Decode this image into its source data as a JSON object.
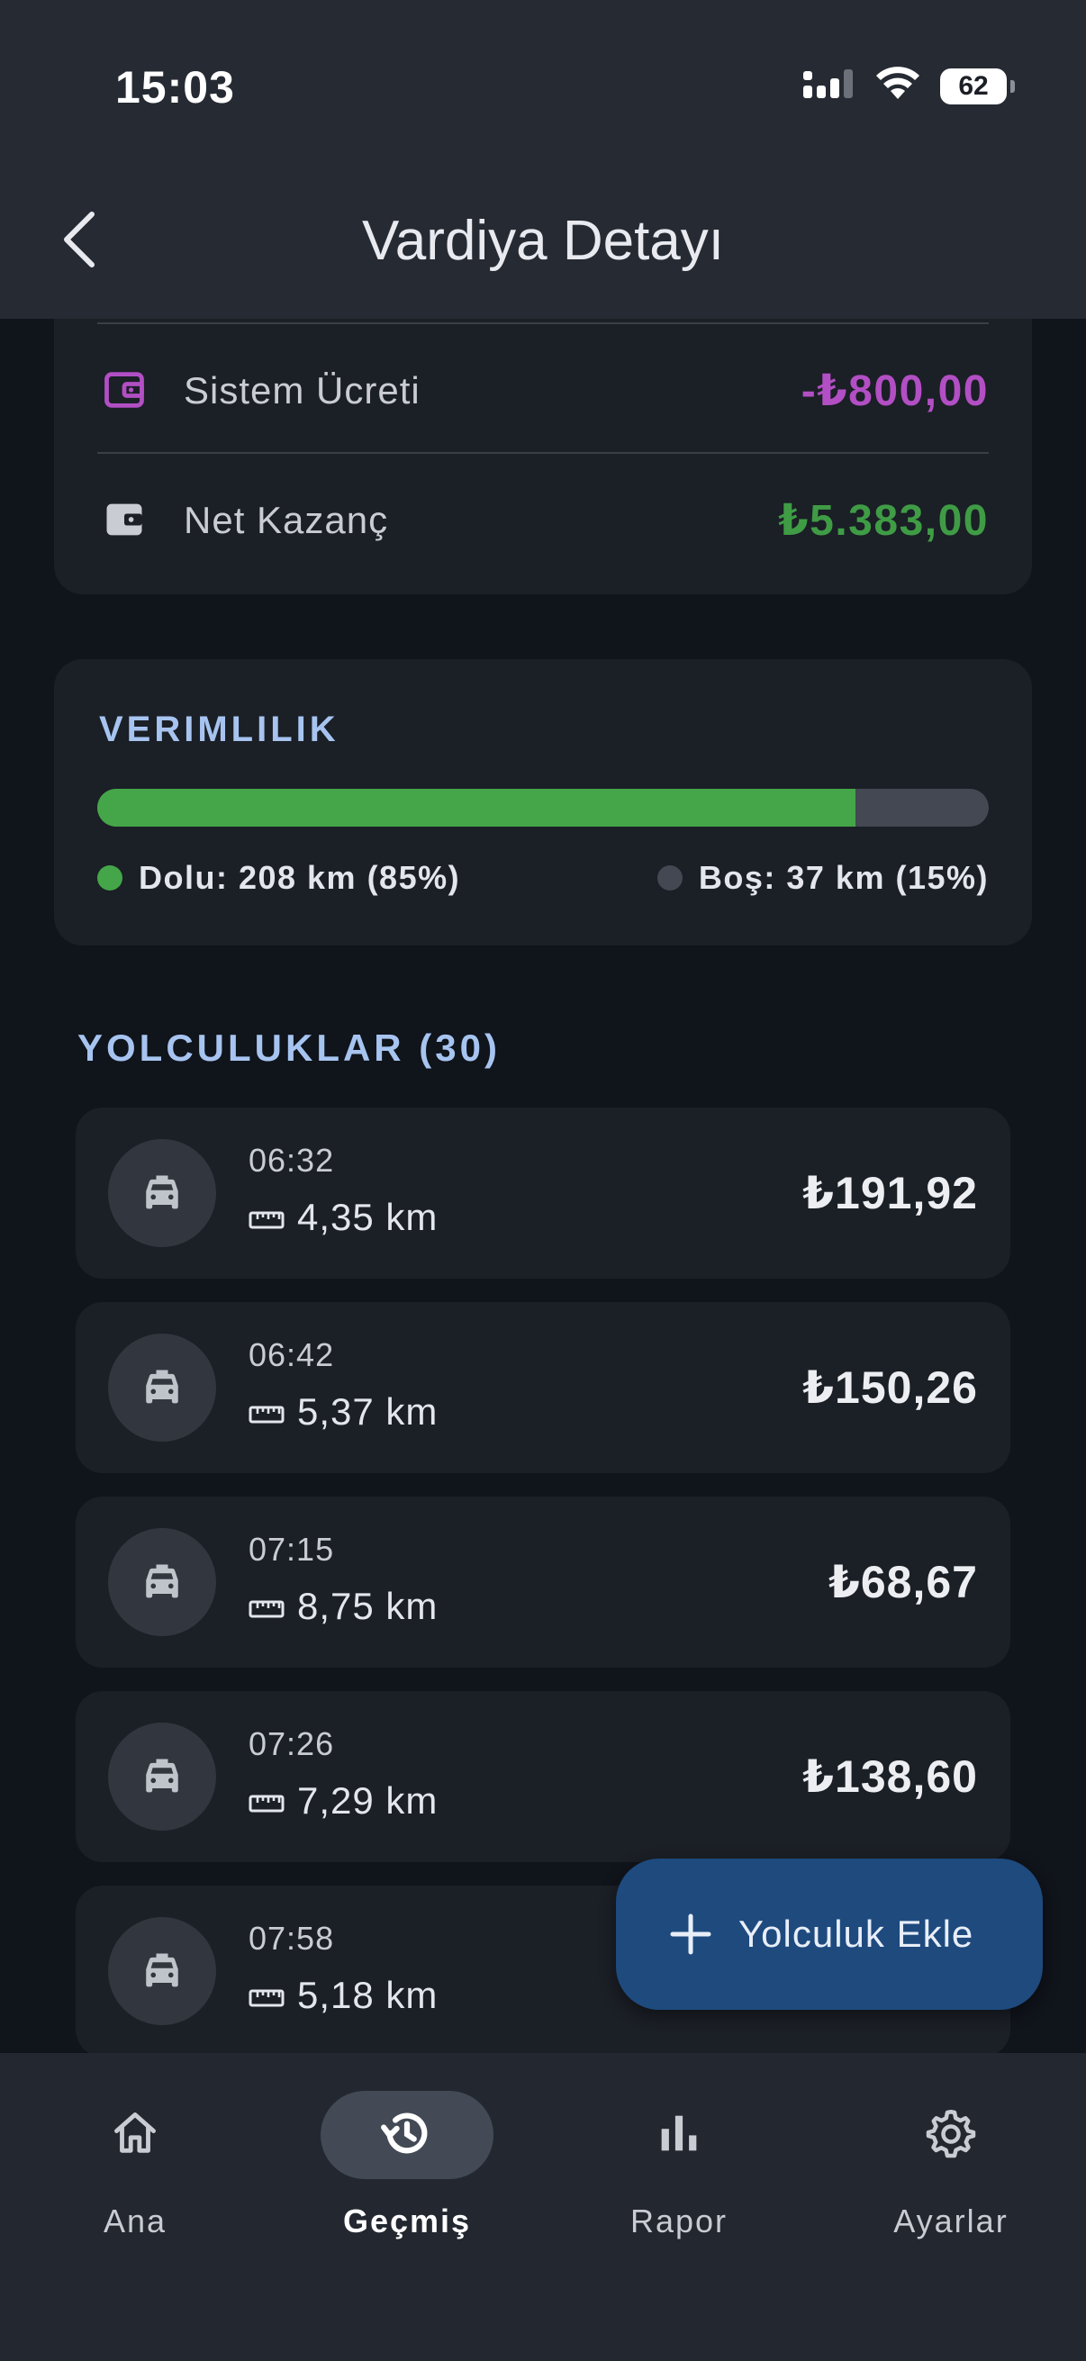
{
  "status_bar": {
    "time": "15:03",
    "battery": "62"
  },
  "header": {
    "title": "Vardiya Detayı"
  },
  "earnings": {
    "system_fee": {
      "label": "Sistem Ücreti",
      "value": "-₺800,00",
      "color": "#b24fc4"
    },
    "net_income": {
      "label": "Net Kazanç",
      "value": "₺5.383,00",
      "color": "#3f9c45"
    }
  },
  "efficiency": {
    "title": "VERIMLILIK",
    "occupied_percent": 85,
    "occupied_label": "Dolu: 208 km (85%)",
    "empty_label": "Boş: 37 km (15%)",
    "occupied_color": "#44a648",
    "empty_color": "#434852"
  },
  "trips": {
    "title": "YOLCULUKLAR (30)",
    "items": [
      {
        "time": "06:32",
        "distance": "4,35 km",
        "price": "₺191,92"
      },
      {
        "time": "06:42",
        "distance": "5,37 km",
        "price": "₺150,26"
      },
      {
        "time": "07:15",
        "distance": "8,75 km",
        "price": "₺68,67"
      },
      {
        "time": "07:26",
        "distance": "7,29 km",
        "price": "₺138,60"
      },
      {
        "time": "07:58",
        "distance": "5,18 km",
        "price": ""
      }
    ]
  },
  "fab": {
    "label": "Yolculuk Ekle"
  },
  "nav": {
    "items": [
      {
        "label": "Ana",
        "icon": "home-icon"
      },
      {
        "label": "Geçmiş",
        "icon": "history-icon",
        "active": true
      },
      {
        "label": "Rapor",
        "icon": "bar-chart-icon"
      },
      {
        "label": "Ayarlar",
        "icon": "gear-icon"
      }
    ]
  }
}
